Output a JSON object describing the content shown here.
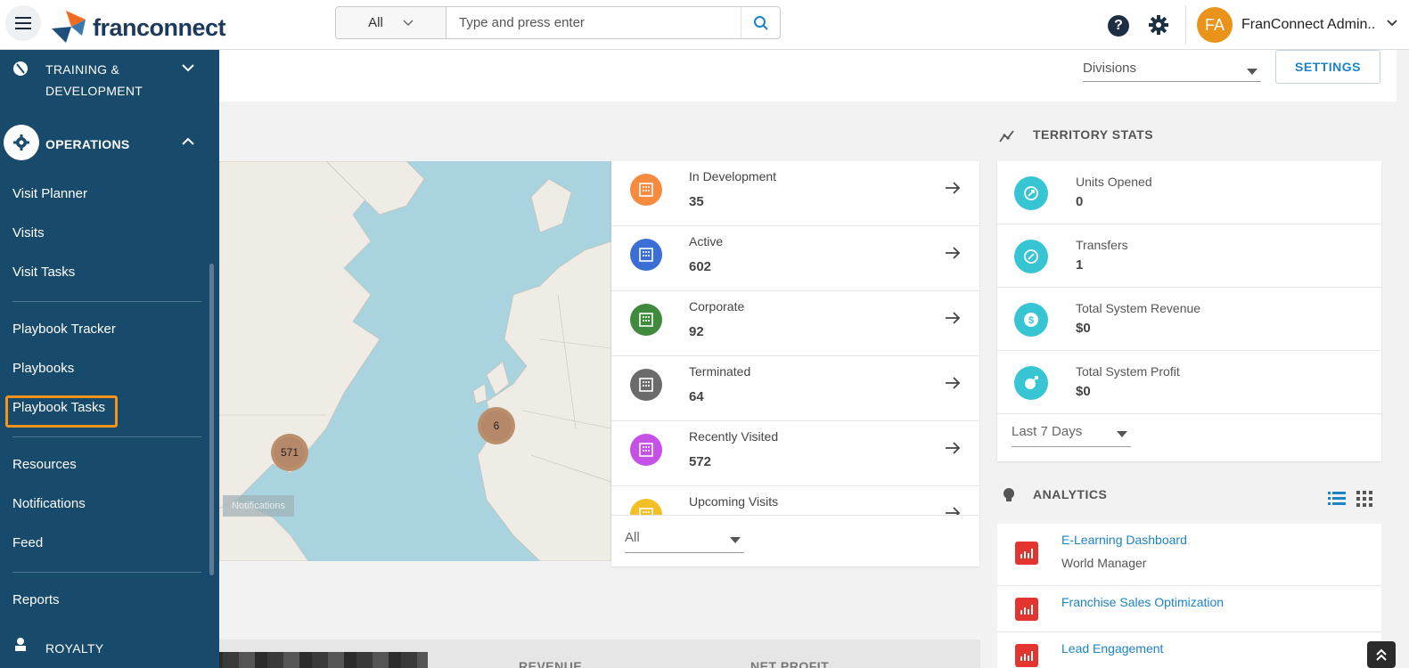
{
  "header": {
    "brand": "franconnect",
    "search_scope": "All",
    "search_placeholder": "Type and press enter",
    "user_initials": "FA",
    "user_name": "FranConnect Admin..."
  },
  "sidebar": {
    "training_label_line1": "TRAINING &",
    "training_label_line2": "DEVELOPMENT",
    "operations_label": "OPERATIONS",
    "items": [
      {
        "label": "Visit Planner"
      },
      {
        "label": "Visits"
      },
      {
        "label": "Visit Tasks"
      },
      {
        "label": "Playbook Tracker"
      },
      {
        "label": "Playbooks"
      },
      {
        "label": "Playbook Tasks"
      },
      {
        "label": "Resources"
      },
      {
        "label": "Notifications"
      },
      {
        "label": "Feed"
      },
      {
        "label": "Reports"
      }
    ],
    "royalty_label": "ROYALTY"
  },
  "filters": {
    "divisions": "Divisions",
    "settings": "SETTINGS"
  },
  "map": {
    "clusters": [
      {
        "count": "6"
      },
      {
        "count": "571"
      }
    ],
    "notifications_tag": "Notifications"
  },
  "status_list": {
    "rows": [
      {
        "label": "In Development",
        "value": "35",
        "color": "#f68b3f"
      },
      {
        "label": "Active",
        "value": "602",
        "color": "#3b6fd6"
      },
      {
        "label": "Corporate",
        "value": "92",
        "color": "#3f8a3c"
      },
      {
        "label": "Terminated",
        "value": "64",
        "color": "#6b6b6b"
      },
      {
        "label": "Recently Visited",
        "value": "572",
        "color": "#c551e6"
      },
      {
        "label": "Upcoming Visits",
        "value": "",
        "color": "#f2bf24"
      }
    ],
    "filter": "All"
  },
  "territory_stats": {
    "title": "TERRITORY STATS",
    "rows": [
      {
        "label": "Units Opened",
        "value": "0"
      },
      {
        "label": "Transfers",
        "value": "1"
      },
      {
        "label": "Total System Revenue",
        "value": "$0"
      },
      {
        "label": "Total System Profit",
        "value": "$0"
      }
    ],
    "filter": "Last 7 Days"
  },
  "analytics": {
    "title": "ANALYTICS",
    "rows": [
      {
        "link": "E-Learning Dashboard",
        "sub": "World Manager"
      },
      {
        "link": "Franchise Sales Optimization",
        "sub": ""
      },
      {
        "link": "Lead Engagement",
        "sub": ""
      }
    ]
  },
  "bottom": {
    "revenue": "REVENUE",
    "net_profit": "NET PROFIT"
  },
  "colors": {
    "sidebar": "#174a6b",
    "accent": "#1c83c7",
    "highlight": "#f7941d"
  }
}
